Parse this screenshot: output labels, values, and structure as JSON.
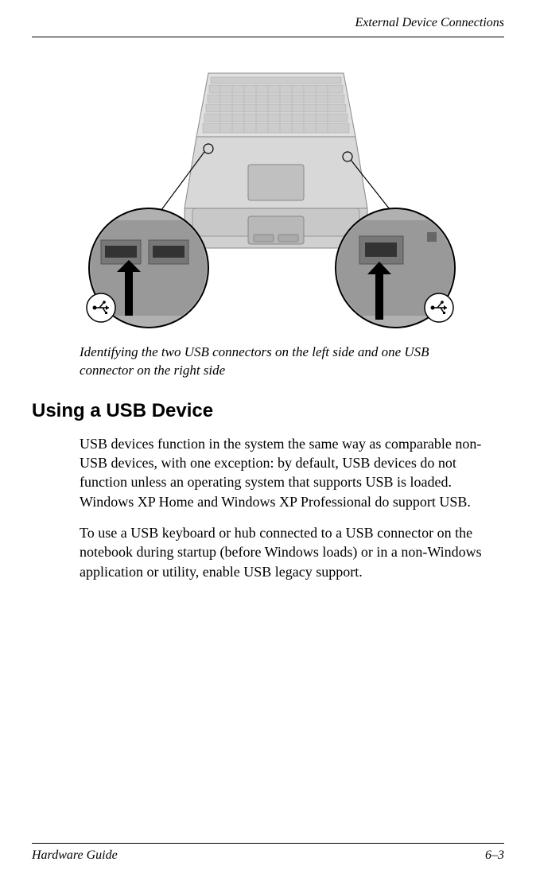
{
  "header": {
    "chapter_title": "External Device Connections"
  },
  "figure": {
    "caption": "Identifying the two USB connectors on the left side and one USB connector on the right side"
  },
  "section": {
    "heading": "Using a USB Device",
    "paragraph1": "USB devices function in the system the same way as comparable non-USB devices, with one exception: by default, USB devices do not function unless an operating system that supports USB is loaded. Windows XP Home and Windows XP Professional do support USB.",
    "paragraph2": "To use a USB keyboard or hub connected to a USB connector on the notebook during startup (before Windows loads) or in a non-Windows application or utility, enable USB legacy support."
  },
  "footer": {
    "doc_title": "Hardware Guide",
    "page_number": "6–3"
  }
}
